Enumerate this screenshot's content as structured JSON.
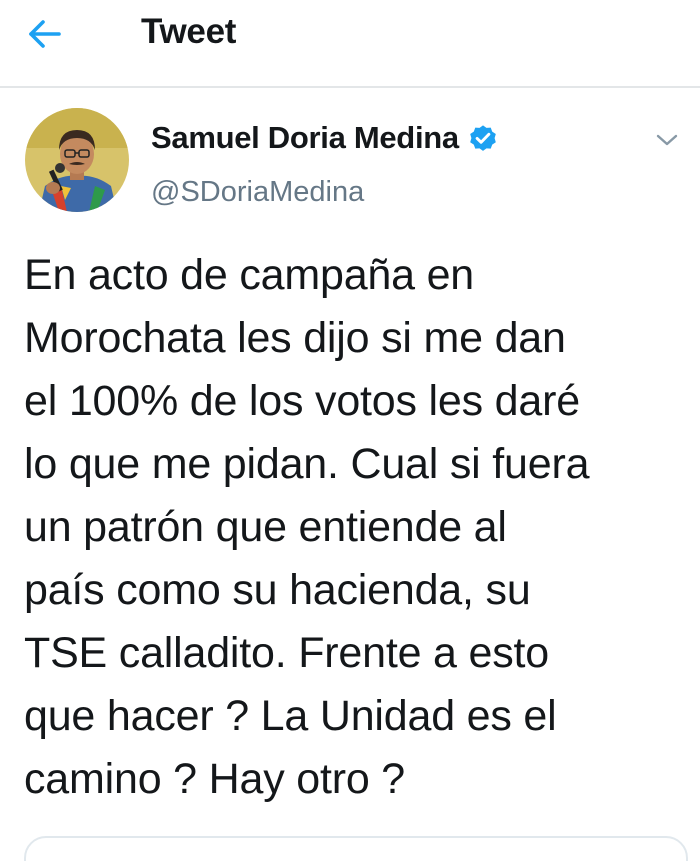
{
  "header": {
    "title": "Tweet",
    "back_icon": "arrow-left-icon"
  },
  "author": {
    "display_name": "Samuel Doria Medina",
    "handle": "@SDoriaMedina",
    "verified": true,
    "verified_icon": "verified-badge-icon",
    "avatar_icon": "avatar-photo"
  },
  "tweet": {
    "text": "En acto de campaña en\nMorochata les dijo si me dan\nel 100% de los votos les daré\nlo que me pidan. Cual si fuera\nun patrón que entiende al\npaís como su hacienda, su\nTSE calladito. Frente a esto\nque hacer ? La Unidad es el\ncamino ? Hay otro ?"
  },
  "menu": {
    "caret_icon": "chevron-down-icon"
  },
  "colors": {
    "accent": "#1da1f2",
    "text_primary": "#14171a",
    "text_secondary": "#657786",
    "divider": "#e3e6e8"
  }
}
